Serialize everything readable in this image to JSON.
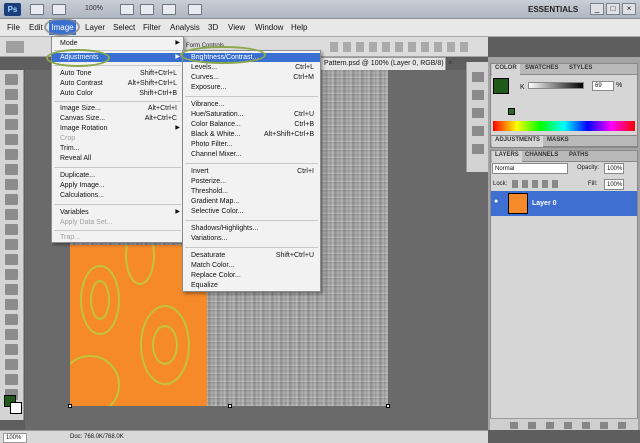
{
  "app": {
    "logo": "Ps",
    "zoom": "100%",
    "workspace": "ESSENTIALS",
    "window_controls": [
      "_",
      "□",
      "×"
    ]
  },
  "menubar": [
    "File",
    "Edit",
    "Image",
    "Layer",
    "Select",
    "Filter",
    "Analysis",
    "3D",
    "View",
    "Window",
    "Help"
  ],
  "options_bar": {
    "label": "Form Controls"
  },
  "document": {
    "tab_title": "Pattern.psd @ 100% (Layer 0, RGB/8) *",
    "close": "×"
  },
  "status": {
    "zoom": "100%",
    "doc_info": "Doc: 768.0K/768.0K"
  },
  "image_menu": {
    "items": [
      {
        "label": "Mode",
        "shortcut": "",
        "submenu": true,
        "disabled": false
      },
      {
        "label": "Adjustments",
        "shortcut": "",
        "submenu": true,
        "disabled": false,
        "highlighted": true
      },
      {
        "label": "Auto Tone",
        "shortcut": "Shift+Ctrl+L",
        "submenu": false,
        "disabled": false
      },
      {
        "label": "Auto Contrast",
        "shortcut": "Alt+Shift+Ctrl+L",
        "submenu": false,
        "disabled": false
      },
      {
        "label": "Auto Color",
        "shortcut": "Shift+Ctrl+B",
        "submenu": false,
        "disabled": false
      },
      {
        "label": "Image Size...",
        "shortcut": "Alt+Ctrl+I",
        "submenu": false,
        "disabled": false
      },
      {
        "label": "Canvas Size...",
        "shortcut": "Alt+Ctrl+C",
        "submenu": false,
        "disabled": false
      },
      {
        "label": "Image Rotation",
        "shortcut": "",
        "submenu": true,
        "disabled": false
      },
      {
        "label": "Crop",
        "shortcut": "",
        "submenu": false,
        "disabled": true
      },
      {
        "label": "Trim...",
        "shortcut": "",
        "submenu": false,
        "disabled": false
      },
      {
        "label": "Reveal All",
        "shortcut": "",
        "submenu": false,
        "disabled": false
      },
      {
        "label": "Duplicate...",
        "shortcut": "",
        "submenu": false,
        "disabled": false
      },
      {
        "label": "Apply Image...",
        "shortcut": "",
        "submenu": false,
        "disabled": false
      },
      {
        "label": "Calculations...",
        "shortcut": "",
        "submenu": false,
        "disabled": false
      },
      {
        "label": "Variables",
        "shortcut": "",
        "submenu": true,
        "disabled": false
      },
      {
        "label": "Apply Data Set...",
        "shortcut": "",
        "submenu": false,
        "disabled": true
      },
      {
        "label": "Trap...",
        "shortcut": "",
        "submenu": false,
        "disabled": true
      }
    ]
  },
  "adjustments_menu": {
    "items": [
      {
        "label": "Brightness/Contrast...",
        "shortcut": "",
        "highlighted": true
      },
      {
        "label": "Levels...",
        "shortcut": "Ctrl+L"
      },
      {
        "label": "Curves...",
        "shortcut": "Ctrl+M"
      },
      {
        "label": "Exposure...",
        "shortcut": ""
      },
      {
        "label": "Vibrance...",
        "shortcut": ""
      },
      {
        "label": "Hue/Saturation...",
        "shortcut": "Ctrl+U"
      },
      {
        "label": "Color Balance...",
        "shortcut": "Ctrl+B"
      },
      {
        "label": "Black & White...",
        "shortcut": "Alt+Shift+Ctrl+B"
      },
      {
        "label": "Photo Filter...",
        "shortcut": ""
      },
      {
        "label": "Channel Mixer...",
        "shortcut": ""
      },
      {
        "label": "Invert",
        "shortcut": "Ctrl+I"
      },
      {
        "label": "Posterize...",
        "shortcut": ""
      },
      {
        "label": "Threshold...",
        "shortcut": ""
      },
      {
        "label": "Gradient Map...",
        "shortcut": ""
      },
      {
        "label": "Selective Color...",
        "shortcut": ""
      },
      {
        "label": "Shadows/Highlights...",
        "shortcut": ""
      },
      {
        "label": "Variations...",
        "shortcut": ""
      },
      {
        "label": "Desaturate",
        "shortcut": "Shift+Ctrl+U"
      },
      {
        "label": "Match Color...",
        "shortcut": ""
      },
      {
        "label": "Replace Color...",
        "shortcut": ""
      },
      {
        "label": "Equalize",
        "shortcut": ""
      }
    ]
  },
  "color_panel": {
    "tabs": [
      "COLOR",
      "SWATCHES",
      "STYLES"
    ],
    "channel": "K",
    "value": "69",
    "unit": "%",
    "foreground": "#1f5a18"
  },
  "adjustments_panel": {
    "tabs": [
      "ADJUSTMENTS",
      "MASKS"
    ]
  },
  "layers_panel": {
    "tabs": [
      "LAYERS",
      "CHANNELS",
      "PATHS"
    ],
    "blend_mode": "Normal",
    "opacity_label": "Opacity:",
    "opacity": "100%",
    "lock_label": "Lock:",
    "fill_label": "Fill:",
    "fill": "100%",
    "layers": [
      {
        "name": "Layer 0"
      }
    ]
  }
}
